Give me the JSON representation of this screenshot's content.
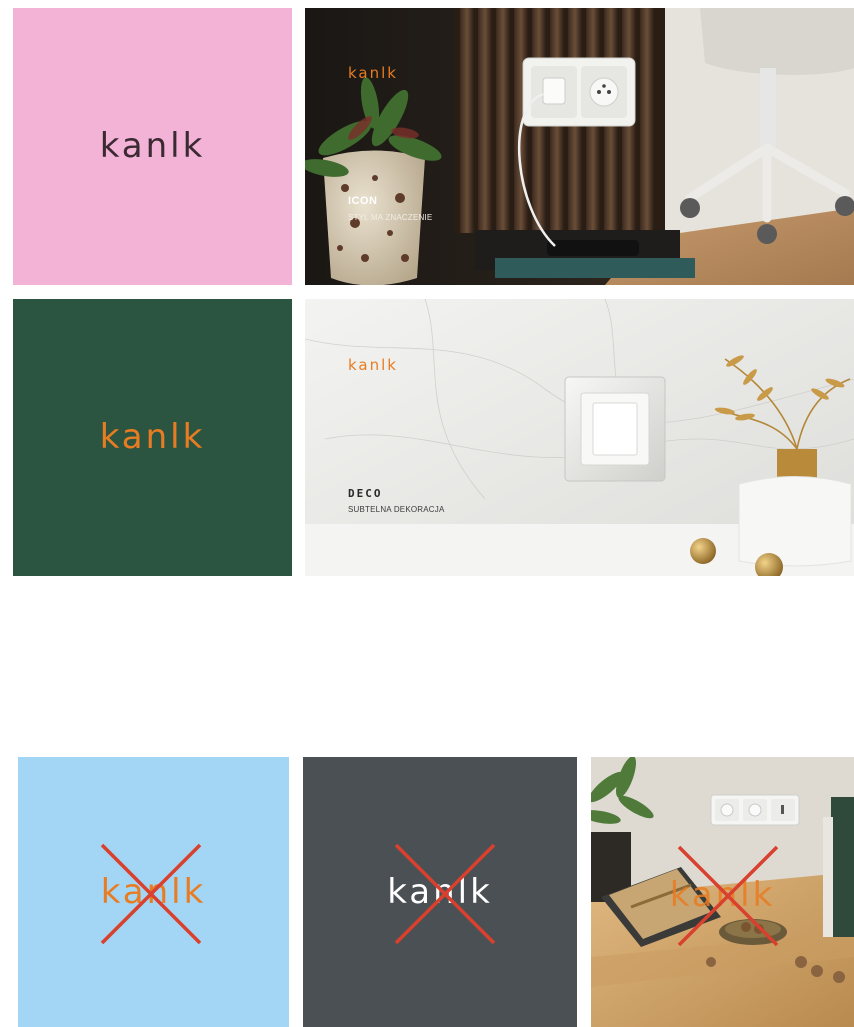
{
  "brand": {
    "name": "kanlk"
  },
  "tiles": {
    "pink_logo": {
      "logo_text": "kanlk"
    },
    "icon_photo": {
      "logo_text": "kanlk",
      "title": "ICON",
      "subtitle": "STYL MA ZNACZENIE"
    },
    "green_logo": {
      "logo_text": "kanlk"
    },
    "deco_photo": {
      "logo_text": "kanlk",
      "title": "DECO",
      "subtitle": "SUBTELNA DEKORACJA"
    },
    "wrong_blue": {
      "logo_text": "kanlk"
    },
    "wrong_grey": {
      "logo_text": "kanlk"
    },
    "wrong_photo": {
      "logo_text": "kanlk"
    }
  },
  "colors": {
    "pink": "#f3b3d6",
    "green": "#2c5541",
    "light_blue": "#a3d6f5",
    "dark_grey": "#4b5054",
    "orange": "#e87c22",
    "dark_text": "#3b2a33",
    "cross_red": "#d9402d"
  }
}
